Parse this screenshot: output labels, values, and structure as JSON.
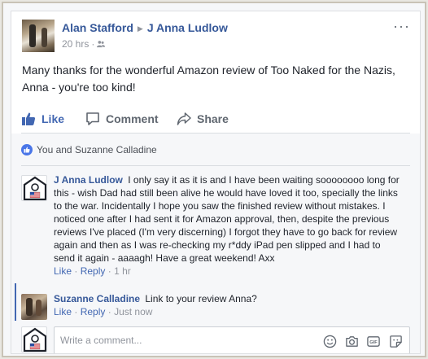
{
  "post": {
    "author": "Alan Stafford",
    "target": "J Anna Ludlow",
    "time": "20 hrs",
    "dot": "·",
    "more": "···",
    "text_line1": "Many thanks for the wonderful Amazon review of Too Naked for the Nazis,",
    "text_line2": "Anna - you're too kind!"
  },
  "actions": {
    "like": "Like",
    "comment": "Comment",
    "share": "Share"
  },
  "reactions": {
    "text": "You and Suzanne Calladine"
  },
  "comments": [
    {
      "name": "J Anna Ludlow",
      "lines": [
        "I only say it as it is and I have been waiting soooooooo long for",
        "this - wish Dad had still been alive he would have loved it too, specially the links",
        "to the war. Incidentally I hope you saw the finished review without mistakes. I",
        "noticed one after I had sent it for Amazon approval, then, despite the previous",
        "reviews I've placed (I'm very discerning) I forgot they have to go back for review",
        "again and then as I was re-checking my r*ddy iPad pen slipped and I had to",
        "send it again - aaaagh! Have a great weekend! Axx"
      ],
      "like": "Like",
      "reply": "Reply",
      "sep": "·",
      "time": "1 hr"
    },
    {
      "name": "Suzanne Calladine",
      "text": "Link to your review Anna?",
      "like": "Like",
      "reply": "Reply",
      "sep": "·",
      "time": "Just now"
    }
  ],
  "composer": {
    "placeholder": "Write a comment..."
  },
  "colors": {
    "link": "#365899",
    "accent": "#4267b2",
    "muted": "#90949c"
  }
}
